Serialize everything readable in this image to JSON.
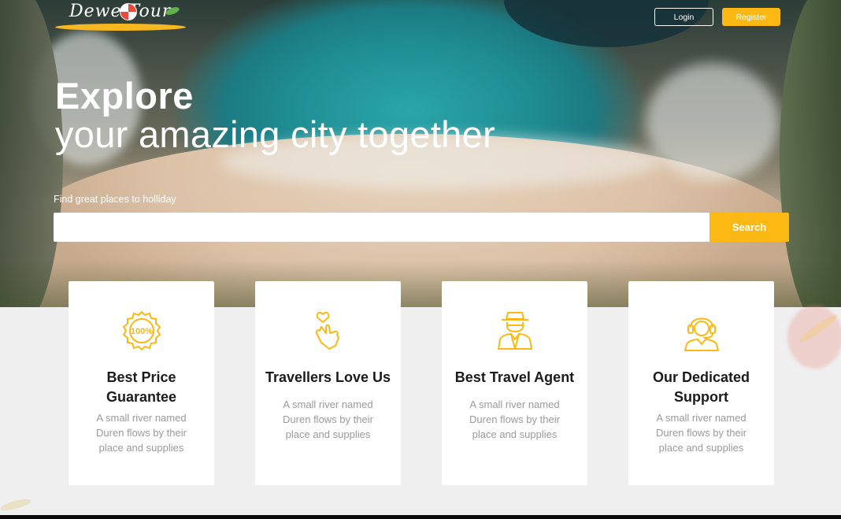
{
  "header": {
    "logo_text": "Dewe Tour",
    "login_label": "Login",
    "register_label": "Register"
  },
  "hero": {
    "title": "Explore",
    "subtitle": "your amazing city together",
    "search_label": "Find great places to holliday",
    "search_placeholder": "",
    "search_button": "Search"
  },
  "features": [
    {
      "icon": "hundred-percent-badge-icon",
      "title": "Best Price Guarantee",
      "description": "A small river named Duren flows by their place and supplies"
    },
    {
      "icon": "finger-heart-icon",
      "title": "Travellers Love Us",
      "description": "A small river named Duren flows by their place and supplies"
    },
    {
      "icon": "travel-agent-icon",
      "title": "Best Travel Agent",
      "description": "A small river named Duren flows by their place and supplies"
    },
    {
      "icon": "support-headset-icon",
      "title": "Our Dedicated Support",
      "description": "A small river named Duren flows by their place and supplies"
    }
  ],
  "colors": {
    "accent": "#fdb913",
    "card_background": "#ffffff",
    "page_background": "#efefef",
    "heading": "#1b1b1b",
    "muted_text": "#9a9a9a"
  }
}
